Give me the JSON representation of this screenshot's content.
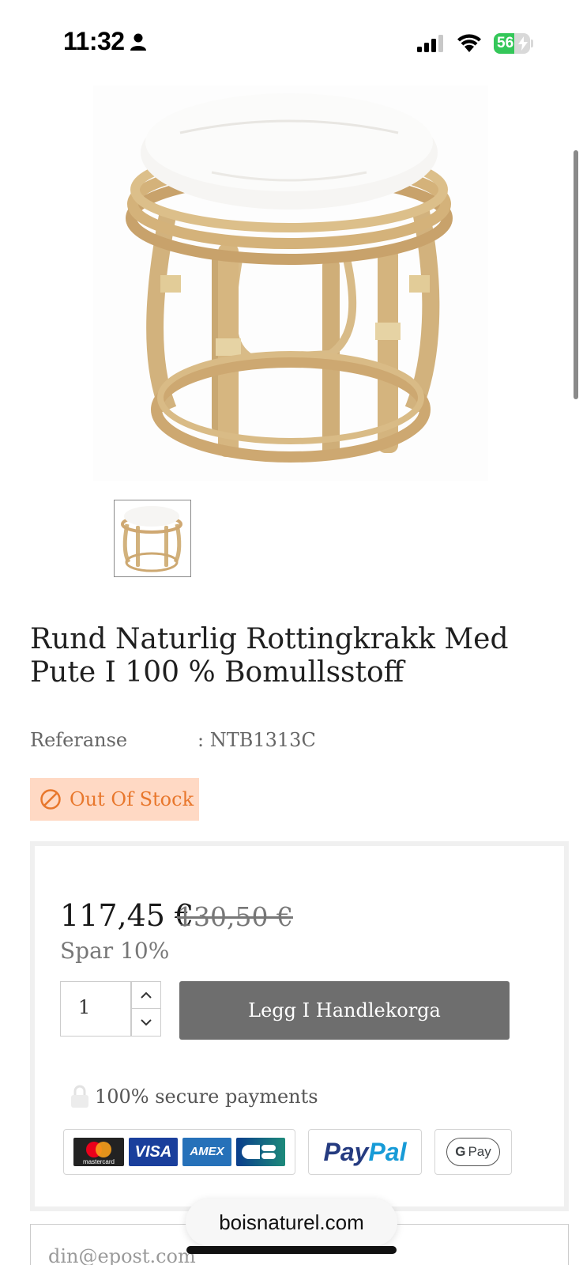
{
  "status_bar": {
    "time": "11:32",
    "battery_level": "56",
    "battery_fraction": 0.56
  },
  "product": {
    "image_alt": "",
    "title": "Rund Naturlig Rottingkrakk Med Pute I 100 % Bomullsstoff",
    "reference_label": "Referanse",
    "reference_value": ": NTB1313C",
    "stock_status": "Out Of Stock"
  },
  "purchase": {
    "price_current": "117,45 €",
    "price_old": "130,50 €",
    "discount_text": "Spar 10%",
    "quantity": "1",
    "add_to_cart_label": "Legg I Handlekorga",
    "secure_text": "100% secure payments"
  },
  "payment_methods": {
    "mastercard_label": "mastercard",
    "visa_label": "VISA",
    "amex_label": "AMEX",
    "cb_label": "CB",
    "paypal_pay": "Pay",
    "paypal_pal": "Pal",
    "gpay_g": "G",
    "gpay_label": "Pay"
  },
  "newsletter": {
    "email_placeholder": "din@epost.com"
  },
  "browser": {
    "url": "boisnaturel.com"
  },
  "colors": {
    "out_of_stock_bg": "#ffd9c4",
    "out_of_stock_text": "#e8772c",
    "button_bg": "#6e6e6e",
    "battery_green": "#34c759"
  }
}
